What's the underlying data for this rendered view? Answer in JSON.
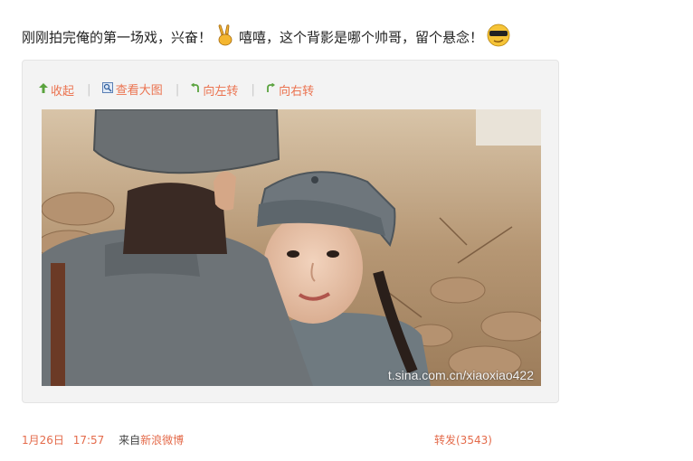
{
  "post": {
    "text_part1": "刚刚拍完俺的第一场戏，兴奋！",
    "text_part2": "嘻嘻，这个背影是哪个帅哥，留个悬念！",
    "emoji_1": "victory-hand-emoji",
    "emoji_2": "cool-sunglasses-emoji"
  },
  "toolbar": {
    "collapse_label": "收起",
    "view_large_label": "查看大图",
    "rotate_left_label": "向左转",
    "rotate_right_label": "向右转",
    "separator": "|"
  },
  "photo": {
    "watermark": "t.sina.com.cn/xiaoxiao422"
  },
  "footer": {
    "date": "1月26日",
    "time": "17:57",
    "source_prefix": "来自",
    "source_name": "新浪微博",
    "repost_label": "转发(3543)"
  },
  "colors": {
    "link": "#eb7350",
    "background": "#ffffff",
    "media_panel": "#f3f3f3"
  }
}
